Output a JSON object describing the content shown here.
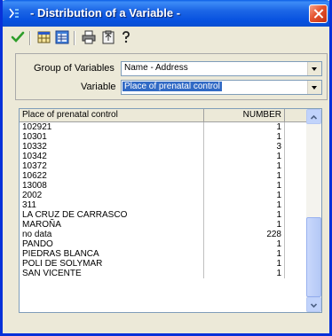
{
  "window": {
    "title": "- Distribution of a Variable -"
  },
  "toolbar": {
    "buttons": [
      {
        "name": "accept",
        "icon": "checkmark-icon"
      },
      {
        "name": "open-table",
        "icon": "table-icon"
      },
      {
        "name": "export",
        "icon": "spreadsheet-icon"
      },
      {
        "name": "print",
        "icon": "printer-icon"
      },
      {
        "name": "copy",
        "icon": "clipboard-icon"
      },
      {
        "name": "help",
        "icon": "question-icon"
      }
    ]
  },
  "filters": {
    "group_label": "Group of Variables",
    "group_value": "Name - Address",
    "variable_label": "Variable",
    "variable_value": "Place of prenatal control"
  },
  "table": {
    "columns": [
      "Place of prenatal control",
      "NUMBER"
    ],
    "rows": [
      {
        "name": "102921",
        "count": "1"
      },
      {
        "name": "10301",
        "count": "1"
      },
      {
        "name": "10332",
        "count": "3"
      },
      {
        "name": "10342",
        "count": "1"
      },
      {
        "name": "10372",
        "count": "1"
      },
      {
        "name": "10622",
        "count": "1"
      },
      {
        "name": "13008",
        "count": "1"
      },
      {
        "name": "2002",
        "count": "1"
      },
      {
        "name": "311",
        "count": "1"
      },
      {
        "name": "LA CRUZ DE CARRASCO",
        "count": "1"
      },
      {
        "name": "MAROÑA",
        "count": "1"
      },
      {
        "name": "no data",
        "count": "228"
      },
      {
        "name": "PANDO",
        "count": "1"
      },
      {
        "name": "PIEDRAS BLANCA",
        "count": "1"
      },
      {
        "name": "POLI DE SOLYMAR",
        "count": "1"
      },
      {
        "name": "SAN VICENTE",
        "count": "1"
      }
    ]
  },
  "colors": {
    "titlebar": "#0a5ee6",
    "selection": "#316ac5",
    "close": "#e5532d"
  }
}
